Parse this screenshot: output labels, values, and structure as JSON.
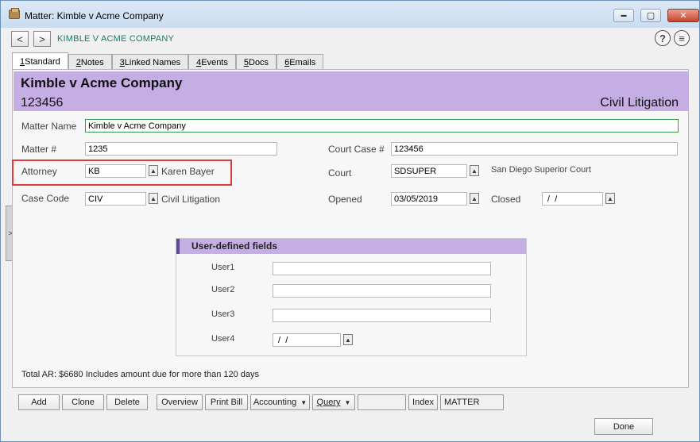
{
  "window": {
    "title": "Matter: Kimble v Acme Company",
    "min_glyph": "▬",
    "max_glyph": "▢",
    "close_glyph": "✕"
  },
  "nav": {
    "back_glyph": "<",
    "forward_glyph": ">",
    "header": "KIMBLE V ACME COMPANY",
    "help_glyph": "?",
    "menu_glyph": "≡"
  },
  "tabs": [
    {
      "key": "1",
      "rest": " Standard"
    },
    {
      "key": "2",
      "rest": " Notes"
    },
    {
      "key": "3",
      "rest": " Linked Names"
    },
    {
      "key": "4",
      "rest": " Events"
    },
    {
      "key": "5",
      "rest": " Docs"
    },
    {
      "key": "6",
      "rest": " Emails"
    }
  ],
  "banner": {
    "title": "Kimble v Acme Company",
    "number": "123456",
    "case_type": "Civil Litigation"
  },
  "form": {
    "matter_name_label": "Matter Name",
    "matter_name_value": "Kimble v Acme Company",
    "matter_num_label": "Matter #",
    "matter_num_value": "1235",
    "court_case_label": "Court Case #",
    "court_case_value": "123456",
    "attorney_label": "Attorney",
    "attorney_code": "KB",
    "attorney_name": "Karen Bayer",
    "court_label": "Court",
    "court_code": "SDSUPER",
    "court_name": "San Diego Superior Court",
    "case_code_label": "Case Code",
    "case_code_value": "CIV",
    "case_code_desc": "Civil Litigation",
    "opened_label": "Opened",
    "opened_value": "03/05/2019",
    "closed_label": "Closed",
    "closed_value": " /  /"
  },
  "udf": {
    "title": "User-defined fields",
    "user1_label": "User1",
    "user1_value": "",
    "user2_label": "User2",
    "user2_value": "",
    "user3_label": "User3",
    "user3_value": "",
    "user4_label": "User4",
    "user4_value": " /  /"
  },
  "lookup_glyph": "▲",
  "side_tab_glyph": ">",
  "total_ar": "Total AR: $6680 Includes amount due for more than 120 days",
  "buttons": {
    "add": "Add",
    "clone": "Clone",
    "delete": "Delete",
    "overview": "Overview",
    "print_bill": "Print Bill",
    "accounting": "Accounting",
    "query": "Query",
    "dropdown_glyph": "▼",
    "query_value": "",
    "index": "Index",
    "index_value": "MATTER",
    "done": "Done"
  }
}
